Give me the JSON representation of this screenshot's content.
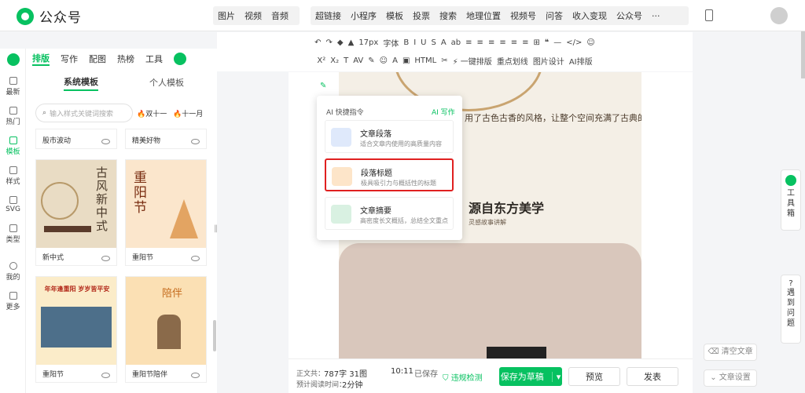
{
  "app": {
    "name": "公众号"
  },
  "nav": {
    "group1": [
      "图片",
      "视频",
      "音频"
    ],
    "group2": [
      "超链接",
      "小程序",
      "模板",
      "投票",
      "搜索",
      "地理位置",
      "视频号",
      "问答",
      "收入变现",
      "公众号",
      "···"
    ]
  },
  "toolbar": {
    "row1": [
      "↶",
      "↷",
      "◆",
      "▲",
      "17px",
      "字体",
      "B",
      "I",
      "U",
      "S",
      "A",
      "ab",
      "≡",
      "≡",
      "≡",
      "≡",
      "≡",
      "≡",
      "⊞",
      "❝",
      "—",
      "</>",
      "☺"
    ],
    "row2": [
      "X²",
      "X₂",
      "T",
      "AV",
      "✎",
      "☺",
      "A",
      "▣",
      "HTML",
      "✂",
      "⚡ 一键排版",
      "重点划线",
      "图片设计",
      "AI排版"
    ]
  },
  "rail": [
    {
      "label": "",
      "icon": "logo"
    },
    {
      "label": "最新"
    },
    {
      "label": "热门"
    },
    {
      "label": "模板"
    },
    {
      "label": "样式"
    },
    {
      "label": "SVG"
    },
    {
      "label": "类型"
    },
    {
      "label": "我的"
    },
    {
      "label": "更多"
    }
  ],
  "paneltabs": {
    "t1": "排版",
    "t2": "写作",
    "t3": "配图",
    "t4": "热榜",
    "t5": "工具"
  },
  "panel": {
    "tab_sys": "系统模板",
    "tab_personal": "个人模板",
    "search_placeholder": "输入样式关键词搜索",
    "tag1": "双十一",
    "tag2": "十一月"
  },
  "cards": [
    {
      "label": "股市波动"
    },
    {
      "label": "精美好物"
    },
    {
      "label": "新中式",
      "poster": "古风新中式"
    },
    {
      "label": "重阳节",
      "poster": "重阳节"
    },
    {
      "label": "重阳节",
      "poster": "年年逢重阳 岁岁皆平安"
    },
    {
      "label": "重阳节陪伴",
      "poster": "陪伴"
    }
  ],
  "popup": {
    "header": "AI 快捷指令",
    "ai_write": "AI 写作",
    "items": [
      {
        "title": "文章段落",
        "desc": "适合文章内使用的高质量内容",
        "color": "#dfe9fb"
      },
      {
        "title": "段落标题",
        "desc": "极具吸引力与概括性的标题",
        "color": "#fde5c9"
      },
      {
        "title": "文章摘要",
        "desc": "高密度长文概括，总结全文重点",
        "color": "#d9f1e2"
      }
    ]
  },
  "article": {
    "text1": "用了古色古香的风格，让整个空间充满了古典的",
    "heading": "源自东方美学",
    "sub": "灵感故事讲解"
  },
  "bottom": {
    "count_label": "正文共：",
    "count": "787字 31图",
    "read_label": "预计阅读时间：",
    "read": "2分钟",
    "time": "10:11",
    "saved": "已保存",
    "check": "违规检测",
    "save": "保存为草稿",
    "preview": "预览",
    "publish": "发表"
  },
  "right": {
    "toolbox": "工具箱",
    "issue": "遇到问题",
    "clear": "清空文章",
    "settings": "文章设置"
  },
  "colors": {
    "green": "#07c160",
    "red": "#e02020"
  }
}
